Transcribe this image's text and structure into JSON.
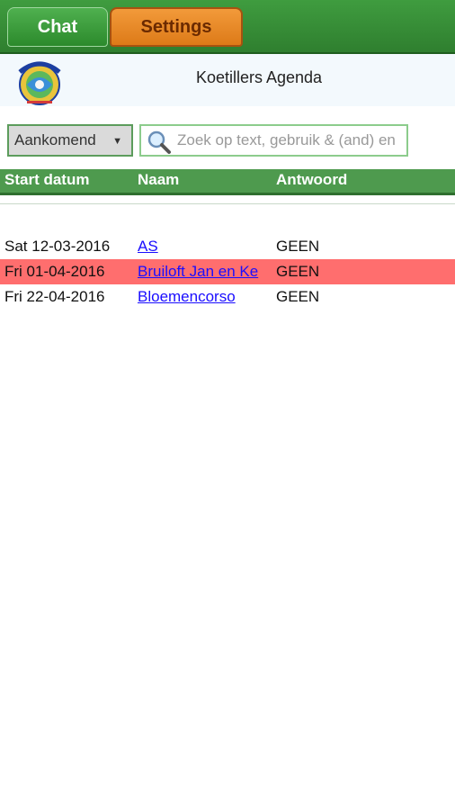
{
  "tabs": {
    "chat_label": "Chat",
    "settings_label": "Settings"
  },
  "header": {
    "title": "Koetillers Agenda",
    "logo_text": "de Koetillers"
  },
  "filter": {
    "selected": "Aankomend",
    "search_placeholder": "Zoek op text, gebruik & (and) en"
  },
  "table": {
    "columns": [
      "Start datum",
      "Naam",
      "Antwoord"
    ],
    "rows": [
      {
        "date": "Sat 12-03-2016",
        "name": "AS",
        "answer": "GEEN",
        "highlight": false
      },
      {
        "date": "Fri 01-04-2016",
        "name": "Bruiloft Jan en Ke",
        "answer": "GEEN",
        "highlight": true
      },
      {
        "date": "Fri 22-04-2016",
        "name": "Bloemencorso",
        "answer": "GEEN",
        "highlight": false
      }
    ]
  },
  "colors": {
    "tab_bar": "#2f7f2f",
    "settings_tab": "#e8862a",
    "table_header": "#4e9a4e",
    "highlight_row": "#ff6e6e",
    "link": "#1a0dff"
  }
}
